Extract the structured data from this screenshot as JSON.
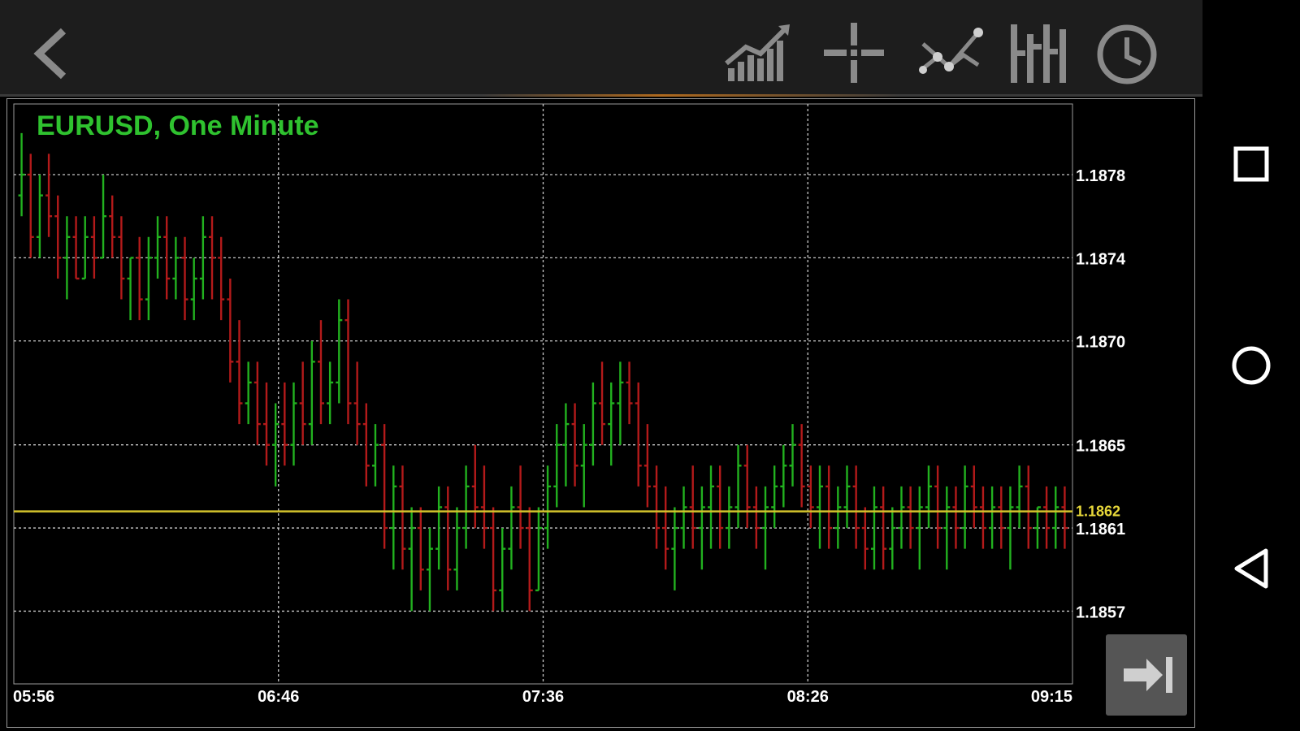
{
  "toolbar": {
    "buttons": [
      {
        "name": "back-button",
        "icon": "chevron-left-icon"
      },
      {
        "name": "indicators-button",
        "icon": "rising-bars-icon"
      },
      {
        "name": "crosshair-button",
        "icon": "crosshair-icon"
      },
      {
        "name": "objects-button",
        "icon": "trendline-icon"
      },
      {
        "name": "chart-type-button",
        "icon": "bar-chart-type-icon"
      },
      {
        "name": "timeframe-button",
        "icon": "clock-icon"
      }
    ]
  },
  "nav": {
    "buttons": [
      "square-icon",
      "circle-icon",
      "triangle-back-icon"
    ]
  },
  "colors": {
    "up": "#22b11f",
    "down": "#b31a1a",
    "grid": "#c8c8c8",
    "axis_text": "#ffffff",
    "price_line": "#d3c22c",
    "price_label": "#e8d83a",
    "title": "#2fc22f"
  },
  "chart_data": {
    "type": "ohlc",
    "title": "EURUSD, One Minute",
    "y_ticks": [
      "1.1878",
      "1.1874",
      "1.1870",
      "1.1865",
      "1.1861",
      "1.1857"
    ],
    "x_ticks": [
      "05:56",
      "06:46",
      "07:36",
      "08:26",
      "09:15"
    ],
    "ylim": [
      1.18535,
      1.18814
    ],
    "current_price_label": "1.1862",
    "current_price": 1.18618,
    "grid": true,
    "bars": [
      [
        1.1877,
        1.188,
        1.1876,
        1.1878
      ],
      [
        1.1878,
        1.1879,
        1.1874,
        1.1875
      ],
      [
        1.1875,
        1.1878,
        1.1874,
        1.1877
      ],
      [
        1.1877,
        1.1879,
        1.1875,
        1.1876
      ],
      [
        1.1876,
        1.1877,
        1.1873,
        1.1874
      ],
      [
        1.1874,
        1.1876,
        1.1872,
        1.1875
      ],
      [
        1.1875,
        1.1876,
        1.1873,
        1.1873
      ],
      [
        1.1873,
        1.1876,
        1.1873,
        1.1875
      ],
      [
        1.1875,
        1.1876,
        1.1873,
        1.1874
      ],
      [
        1.1874,
        1.1878,
        1.1874,
        1.1876
      ],
      [
        1.1876,
        1.1877,
        1.1874,
        1.1875
      ],
      [
        1.1875,
        1.1876,
        1.1872,
        1.1873
      ],
      [
        1.1873,
        1.1874,
        1.1871,
        1.1874
      ],
      [
        1.1874,
        1.1875,
        1.1871,
        1.1872
      ],
      [
        1.1872,
        1.1875,
        1.1871,
        1.1874
      ],
      [
        1.1874,
        1.1876,
        1.1873,
        1.1875
      ],
      [
        1.1875,
        1.1876,
        1.1872,
        1.1873
      ],
      [
        1.1873,
        1.1875,
        1.1872,
        1.1874
      ],
      [
        1.1874,
        1.1875,
        1.1871,
        1.1872
      ],
      [
        1.1872,
        1.1874,
        1.1871,
        1.1873
      ],
      [
        1.1873,
        1.1876,
        1.1872,
        1.1875
      ],
      [
        1.1875,
        1.1876,
        1.1872,
        1.1874
      ],
      [
        1.1874,
        1.1875,
        1.1871,
        1.1872
      ],
      [
        1.1872,
        1.1873,
        1.1868,
        1.1869
      ],
      [
        1.1869,
        1.1871,
        1.1866,
        1.1867
      ],
      [
        1.1867,
        1.1869,
        1.1866,
        1.1868
      ],
      [
        1.1868,
        1.1869,
        1.1865,
        1.1866
      ],
      [
        1.1866,
        1.1868,
        1.1864,
        1.1865
      ],
      [
        1.1865,
        1.1867,
        1.1863,
        1.1866
      ],
      [
        1.1866,
        1.1868,
        1.1864,
        1.1865
      ],
      [
        1.1865,
        1.1868,
        1.1864,
        1.1867
      ],
      [
        1.1867,
        1.1869,
        1.1865,
        1.1866
      ],
      [
        1.1866,
        1.187,
        1.1865,
        1.1869
      ],
      [
        1.1869,
        1.1871,
        1.1866,
        1.1867
      ],
      [
        1.1867,
        1.1869,
        1.1866,
        1.1868
      ],
      [
        1.1868,
        1.1872,
        1.1867,
        1.1871
      ],
      [
        1.1871,
        1.1872,
        1.1866,
        1.1867
      ],
      [
        1.1867,
        1.1869,
        1.1865,
        1.1866
      ],
      [
        1.1866,
        1.1867,
        1.1863,
        1.1864
      ],
      [
        1.1864,
        1.1866,
        1.1863,
        1.1865
      ],
      [
        1.1865,
        1.1866,
        1.186,
        1.1861
      ],
      [
        1.1861,
        1.1864,
        1.1859,
        1.1863
      ],
      [
        1.1863,
        1.1864,
        1.1859,
        1.186
      ],
      [
        1.186,
        1.1862,
        1.1857,
        1.1861
      ],
      [
        1.1861,
        1.1862,
        1.1858,
        1.1859
      ],
      [
        1.1859,
        1.1861,
        1.1857,
        1.186
      ],
      [
        1.186,
        1.1863,
        1.1859,
        1.1862
      ],
      [
        1.1862,
        1.1863,
        1.1858,
        1.1859
      ],
      [
        1.1859,
        1.1862,
        1.1858,
        1.1861
      ],
      [
        1.1861,
        1.1864,
        1.186,
        1.1863
      ],
      [
        1.1863,
        1.1865,
        1.1861,
        1.1862
      ],
      [
        1.1862,
        1.1864,
        1.186,
        1.1861
      ],
      [
        1.1861,
        1.1862,
        1.1857,
        1.1858
      ],
      [
        1.1858,
        1.1861,
        1.1857,
        1.186
      ],
      [
        1.186,
        1.1863,
        1.1859,
        1.1862
      ],
      [
        1.1862,
        1.1864,
        1.186,
        1.1861
      ],
      [
        1.1861,
        1.1862,
        1.1857,
        1.1858
      ],
      [
        1.1858,
        1.1862,
        1.1858,
        1.1861
      ],
      [
        1.1861,
        1.1864,
        1.186,
        1.1863
      ],
      [
        1.1863,
        1.1866,
        1.1862,
        1.1865
      ],
      [
        1.1865,
        1.1867,
        1.1863,
        1.1866
      ],
      [
        1.1866,
        1.1867,
        1.1863,
        1.1864
      ],
      [
        1.1864,
        1.1866,
        1.1862,
        1.1865
      ],
      [
        1.1865,
        1.1868,
        1.1864,
        1.1867
      ],
      [
        1.1867,
        1.1869,
        1.1865,
        1.1866
      ],
      [
        1.1866,
        1.1868,
        1.1864,
        1.1867
      ],
      [
        1.1867,
        1.1869,
        1.1865,
        1.1868
      ],
      [
        1.1868,
        1.1869,
        1.1866,
        1.1867
      ],
      [
        1.1867,
        1.1868,
        1.1863,
        1.1864
      ],
      [
        1.1864,
        1.1866,
        1.1862,
        1.1863
      ],
      [
        1.1863,
        1.1864,
        1.186,
        1.1861
      ],
      [
        1.1861,
        1.1863,
        1.1859,
        1.186
      ],
      [
        1.186,
        1.1862,
        1.1858,
        1.1861
      ],
      [
        1.1861,
        1.1863,
        1.186,
        1.1862
      ],
      [
        1.1862,
        1.1864,
        1.186,
        1.1861
      ],
      [
        1.1861,
        1.1863,
        1.1859,
        1.1862
      ],
      [
        1.1862,
        1.1864,
        1.186,
        1.1863
      ],
      [
        1.1863,
        1.1864,
        1.186,
        1.1861
      ],
      [
        1.1861,
        1.1863,
        1.186,
        1.1862
      ],
      [
        1.1862,
        1.1865,
        1.1861,
        1.1864
      ],
      [
        1.1864,
        1.1865,
        1.1861,
        1.1862
      ],
      [
        1.1862,
        1.1863,
        1.186,
        1.1861
      ],
      [
        1.1861,
        1.1863,
        1.1859,
        1.1862
      ],
      [
        1.1862,
        1.1864,
        1.1861,
        1.1863
      ],
      [
        1.1863,
        1.1865,
        1.1862,
        1.1864
      ],
      [
        1.1864,
        1.1866,
        1.1863,
        1.1865
      ],
      [
        1.1865,
        1.1866,
        1.1862,
        1.1863
      ],
      [
        1.1863,
        1.1864,
        1.1861,
        1.1862
      ],
      [
        1.1862,
        1.1864,
        1.186,
        1.1863
      ],
      [
        1.1863,
        1.1864,
        1.186,
        1.1861
      ],
      [
        1.1861,
        1.1863,
        1.186,
        1.1862
      ],
      [
        1.1862,
        1.1864,
        1.1861,
        1.1863
      ],
      [
        1.1863,
        1.1864,
        1.186,
        1.1861
      ],
      [
        1.1861,
        1.1862,
        1.1859,
        1.186
      ],
      [
        1.186,
        1.1863,
        1.1859,
        1.1862
      ],
      [
        1.1862,
        1.1863,
        1.1859,
        1.186
      ],
      [
        1.186,
        1.1862,
        1.1859,
        1.1861
      ],
      [
        1.1861,
        1.1863,
        1.186,
        1.1862
      ],
      [
        1.1862,
        1.1863,
        1.186,
        1.1861
      ],
      [
        1.1861,
        1.1863,
        1.1859,
        1.1862
      ],
      [
        1.1862,
        1.1864,
        1.1861,
        1.1863
      ],
      [
        1.1863,
        1.1864,
        1.186,
        1.1861
      ],
      [
        1.1861,
        1.1863,
        1.1859,
        1.1862
      ],
      [
        1.1862,
        1.1863,
        1.186,
        1.1861
      ],
      [
        1.1861,
        1.1864,
        1.186,
        1.1863
      ],
      [
        1.1863,
        1.1864,
        1.1861,
        1.1862
      ],
      [
        1.1862,
        1.1863,
        1.186,
        1.1861
      ],
      [
        1.1861,
        1.1863,
        1.186,
        1.1862
      ],
      [
        1.1862,
        1.1863,
        1.186,
        1.1861
      ],
      [
        1.1861,
        1.1863,
        1.1859,
        1.1862
      ],
      [
        1.1862,
        1.1864,
        1.1861,
        1.1863
      ],
      [
        1.1863,
        1.1864,
        1.186,
        1.1861
      ],
      [
        1.1861,
        1.1862,
        1.186,
        1.1862
      ],
      [
        1.1862,
        1.1863,
        1.186,
        1.1861
      ],
      [
        1.1861,
        1.1863,
        1.186,
        1.1862
      ],
      [
        1.1862,
        1.1863,
        1.186,
        1.1861
      ]
    ]
  }
}
